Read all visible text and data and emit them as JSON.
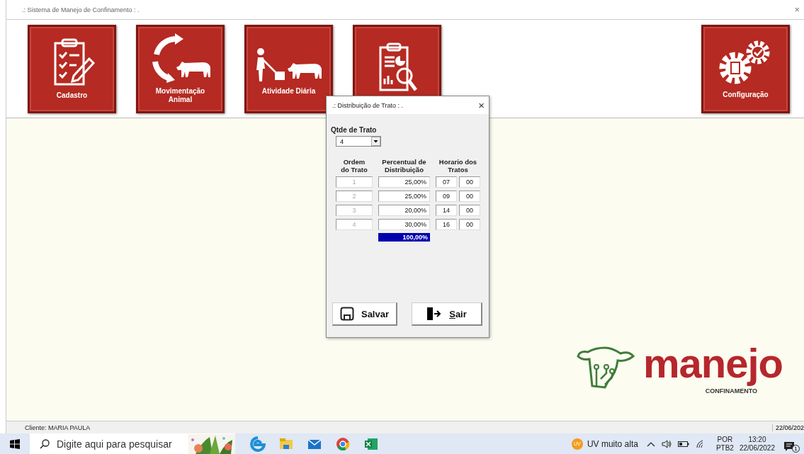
{
  "window": {
    "title": ".: Sistema de Manejo de Confinamento : .",
    "close": "×"
  },
  "tiles": [
    {
      "kind": "clipboard",
      "label": "Cadastro"
    },
    {
      "kind": "cycle",
      "label": "Movimentação Animal"
    },
    {
      "kind": "worker",
      "label": "Atividade Diária"
    },
    {
      "kind": "report"
    }
  ],
  "settings_tile": {
    "kind": "gears",
    "label": "Configuração"
  },
  "dialog": {
    "title": ".: Distribuição de Trato : .",
    "close": "×",
    "qty_label": "Qtde de Trato",
    "qty_value": "4",
    "columns": [
      "Ordem do Trato",
      "Percentual de Distribuição",
      "Horario dos Tratos"
    ],
    "rows": [
      {
        "order": "1",
        "disabled": true,
        "percent": "25,00%",
        "hour": "07",
        "minute": "00"
      },
      {
        "order": "2",
        "disabled": true,
        "percent": "25,00%",
        "hour": "09",
        "minute": "00"
      },
      {
        "order": "3",
        "disabled": true,
        "percent": "20,00%",
        "hour": "14",
        "minute": "00"
      },
      {
        "order": "4",
        "disabled": true,
        "percent": "30,00%",
        "hour": "16",
        "minute": "00"
      }
    ],
    "total": "100,00%",
    "buttons": [
      {
        "kind": "save",
        "label": "Salvar",
        "underline_first": false
      },
      {
        "kind": "exit",
        "label": "Sair",
        "underline_first": true
      }
    ]
  },
  "logo": {
    "word": "manejo",
    "tagline": "CONFINAMENTO"
  },
  "status_bar": {
    "client": "Cliente: MARIA PAULA",
    "date": "22/06/202"
  },
  "taskbar": {
    "search_placeholder": "Digite aqui para pesquisar",
    "weather_badge": "UV",
    "weather": "UV muito alta",
    "language": "POR",
    "layout": "PTB2",
    "time": "13:20",
    "date": "22/06/2022",
    "notifications": "1"
  }
}
